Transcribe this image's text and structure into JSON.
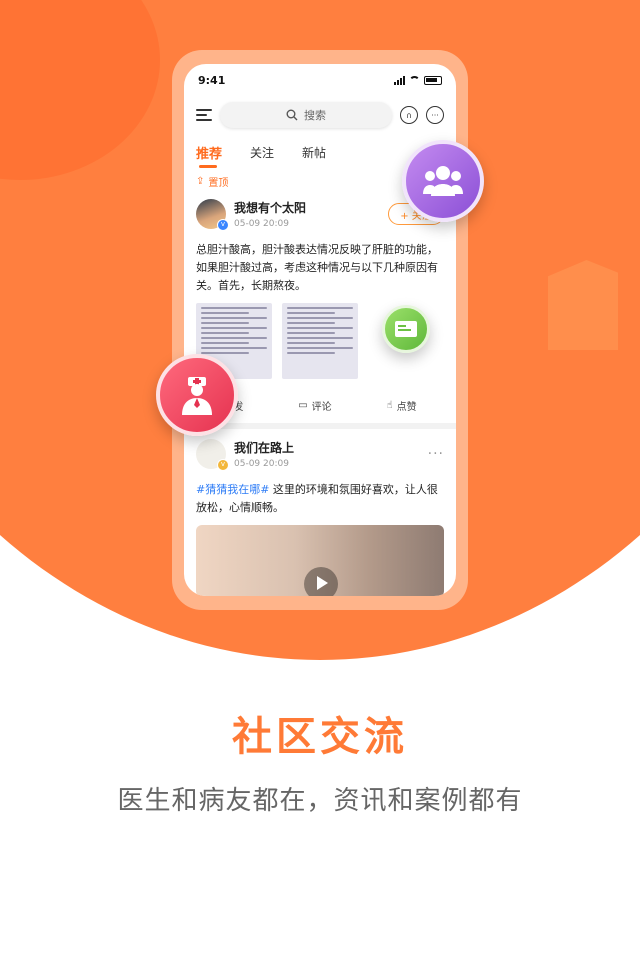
{
  "phone": {
    "status_time": "9:41",
    "search_placeholder": "搜索",
    "tabs": [
      {
        "label": "推荐",
        "active": true
      },
      {
        "label": "关注",
        "active": false
      },
      {
        "label": "新帖",
        "active": false
      }
    ],
    "pinned_label": "置顶",
    "posts": [
      {
        "username": "我想有个太阳",
        "time": "05-09 20:09",
        "follow_label": "+ 关注",
        "text": "总胆汁酸高，胆汁酸表达情况反映了肝脏的功能，如果胆汁酸过高，考虑这种情况与以下几种原因有关。首先，长期熬夜。"
      },
      {
        "username": "我们在路上",
        "time": "05-09 20:09",
        "more_label": "···",
        "hashtag": "#猜猜我在哪#",
        "text": " 这里的环境和氛围好喜欢，让人很放松，心情顺畅。"
      }
    ],
    "actions": {
      "forward": "转发",
      "comment": "评论",
      "like": "点赞"
    }
  },
  "headline": "社区交流",
  "subline": "医生和病友都在，资讯和案例都有",
  "colors": {
    "accent": "#ff7f3f",
    "tab_active": "#ff6b1e",
    "hashtag": "#2f7df6"
  },
  "icons": [
    "group-icon",
    "card-icon",
    "doctor-icon",
    "play-icon",
    "headset-icon",
    "message-icon",
    "search-icon",
    "menu-icon"
  ]
}
